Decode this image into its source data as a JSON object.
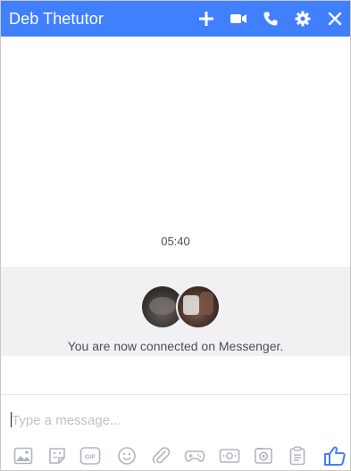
{
  "header": {
    "title": "Deb Thetutor",
    "icons": [
      "plus-icon",
      "video-camera-icon",
      "phone-icon",
      "gear-icon",
      "close-icon"
    ],
    "background": "#4080ff"
  },
  "conversation": {
    "timestamp": "05:40",
    "connected_message": "You are now connected on Messenger."
  },
  "composer": {
    "placeholder": "Type a message...",
    "value": ""
  },
  "toolbar": {
    "icons": [
      "photo-icon",
      "sticker-icon",
      "gif-icon",
      "emoji-icon",
      "attachment-icon",
      "game-icon",
      "money-icon",
      "camera-icon",
      "clipboard-icon",
      "thumbs-up-icon"
    ],
    "accent": "#4080ff"
  }
}
